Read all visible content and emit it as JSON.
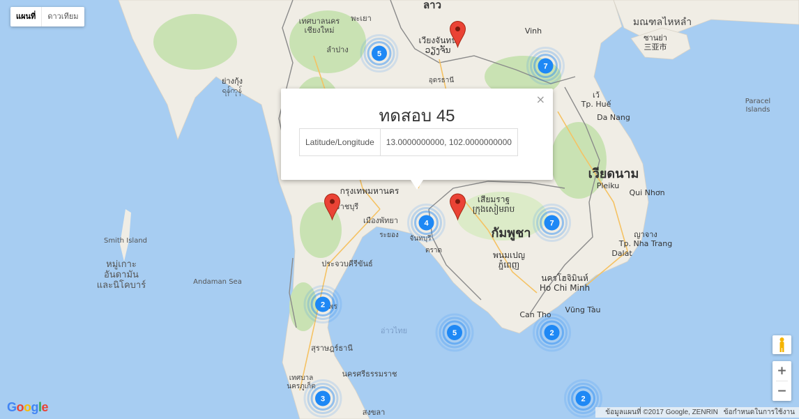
{
  "map_type_control": {
    "map": "แผนที่",
    "satellite": "ดาวเทียม"
  },
  "labels": {
    "laos": "ลาว",
    "chiang_mai": "เทศบาลนคร\nเชียงใหม่",
    "phayao": "พะเยา",
    "lampang": "ลำปาง",
    "vientiane": "เวียงจันทน์\nວຽງຈັນ",
    "udon": "อุดรธานี",
    "vinh": "Vinh",
    "hainan": "มณฑลไหหลำ",
    "sanya": "ซานย่า\n三亚市",
    "yangon": "ย่างกุ้ง\nရန်ကုန်",
    "hue": "เว้\nTp. Huế",
    "danang": "Da Nang",
    "paracel": "Paracel\nIslands",
    "vietnam": "เวียดนาม",
    "pleiku": "Pleiku",
    "quinhon": "Qui Nhơn",
    "bangkok": "กรุงเทพมหานคร",
    "ratchaburi": "ราชบุรี",
    "pattaya": "เมืองพัทยา",
    "rayong": "ระยอง",
    "chanthaburi": "จันทบุรี",
    "trat": "ตราด",
    "siemreap": "เสียมราฐ\nក្រុងសៀមរាប",
    "cambodia": "กัมพูชา",
    "nhatrang": "ญาจาง\nTp. Nha Trang",
    "dalat": "Dalat",
    "phnompenh": "พนมเปญ\nភ្នំពេញ",
    "hcmc": "นครโฮจิมินห์\nHo Chi Minh",
    "vungtau": "Vũng Tàu",
    "canthao": "Can Tho",
    "smith": "Smith Island",
    "andaman_islands": "หมู่เกาะ\nอันดามัน\nและนิโคบาร์",
    "andaman_sea": "Andaman Sea",
    "prachuap": "ประจวบคีรีขันธ์",
    "chumphon": "ชุมพร",
    "surat": "สุราษฎร์ธานี",
    "phuket": "เทศบาล\nนครภูเก็ต",
    "nakhon_si": "นครศรีธรรมราช",
    "songkhla": "สงขลา",
    "gulf": "อ่าวไทย"
  },
  "clusters": [
    {
      "count": "5",
      "lon": 99.5,
      "lat": 18.3
    },
    {
      "count": "7",
      "lon": 104.8,
      "lat": 17.9
    },
    {
      "count": "4",
      "lon": 101.0,
      "lat": 12.9
    },
    {
      "count": "7",
      "lon": 105.0,
      "lat": 12.9
    },
    {
      "count": "2",
      "lon": 97.7,
      "lat": 10.3
    },
    {
      "count": "5",
      "lon": 101.9,
      "lat": 9.4
    },
    {
      "count": "2",
      "lon": 105.0,
      "lat": 9.4
    },
    {
      "count": "3",
      "lon": 97.7,
      "lat": 7.3
    },
    {
      "count": "2",
      "lon": 106.0,
      "lat": 7.3
    }
  ],
  "markers": [
    {
      "lon": 102.0,
      "lat": 18.5
    },
    {
      "lon": 98.0,
      "lat": 13.0
    },
    {
      "lon": 102.0,
      "lat": 13.0
    }
  ],
  "info_window": {
    "title": "ทดสอบ 45",
    "row_label": "Latitude/Longitude",
    "row_value": "13.0000000000, 102.0000000000",
    "close": "×"
  },
  "zoom": {
    "in": "+",
    "out": "−"
  },
  "google_logo": "Google",
  "attribution": {
    "data": "ข้อมูลแผนที่ ©2017 Google, ZENRIN",
    "terms": "ข้อกำหนดในการใช้งาน"
  },
  "colors": {
    "water": "#a7cdf2",
    "land": "#f0ede5",
    "forest": "#c9e2b3",
    "cluster": "#1e88f5",
    "marker": "#ea4335"
  }
}
